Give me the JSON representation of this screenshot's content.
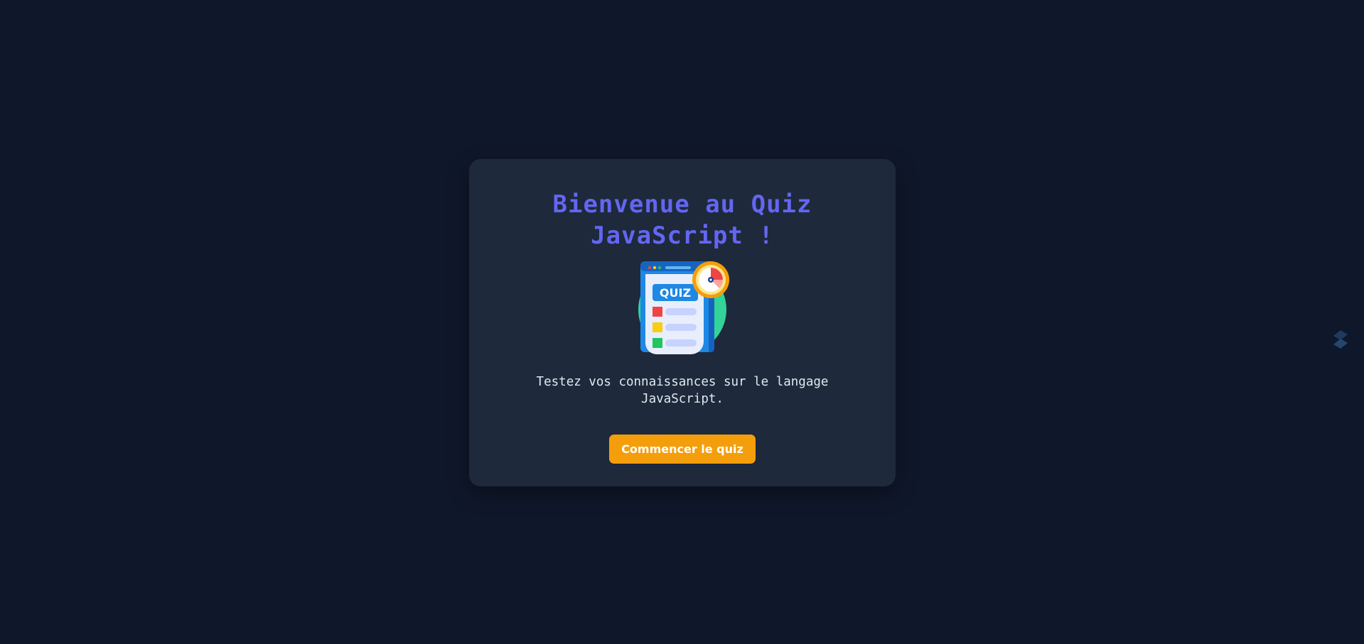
{
  "welcome": {
    "title_line1": "Bienvenue au Quiz",
    "title_line2": "JavaScript !",
    "illustration_badge": "QUIZ",
    "description_line1": "Testez vos connaissances sur le langage",
    "description_line2": "JavaScript.",
    "start_button_label": "Commencer le quiz"
  },
  "colors": {
    "background": "#0f172a",
    "card": "#1e293b",
    "title": "#6366f1",
    "button": "#f59e0b",
    "text": "#e2e8f0"
  },
  "icons": {
    "illustration": "quiz-clipboard-timer-icon",
    "side": "streamlit-like-logo-icon"
  }
}
